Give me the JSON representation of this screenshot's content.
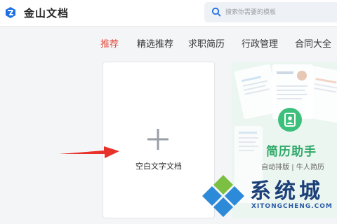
{
  "app": {
    "title": "金山文档"
  },
  "search": {
    "placeholder": "搜索你需要的模板",
    "value": ""
  },
  "tabs": [
    {
      "label": "推荐",
      "active": true
    },
    {
      "label": "精选推荐",
      "active": false
    },
    {
      "label": "求职简历",
      "active": false
    },
    {
      "label": "行政管理",
      "active": false
    },
    {
      "label": "合同大全",
      "active": false
    }
  ],
  "blank_card": {
    "label": "空白文字文档",
    "icon": "plus-icon"
  },
  "template_card": {
    "title": "简历助手",
    "subtitle": "自动排版 | 牛人简历",
    "icon": "resume-icon"
  },
  "watermark": {
    "text": "系统城",
    "domain": "XITONGCHENG.COM"
  },
  "colors": {
    "active_tab": "#e14c3c",
    "brand_blue": "#1f6fe5",
    "resume_green": "#3cc07b",
    "arrow_red": "#e8312a"
  }
}
